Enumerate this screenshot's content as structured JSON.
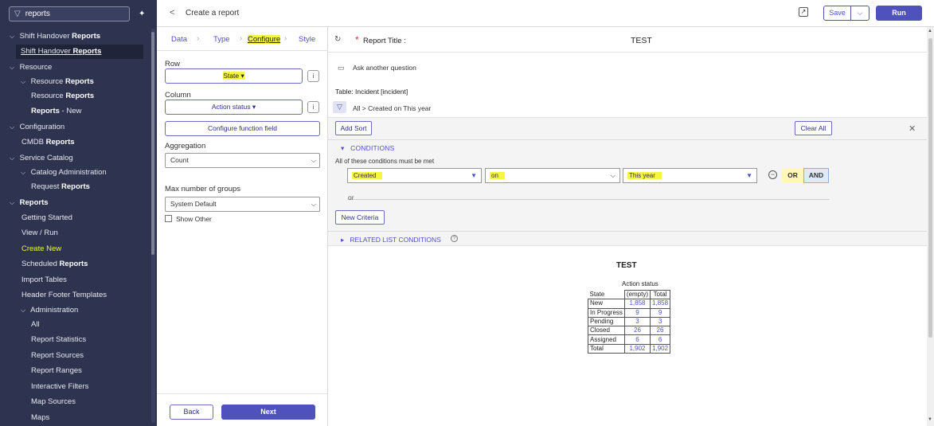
{
  "nav": {
    "search_value": "reports",
    "items": [
      {
        "prefix": "Shift Handover ",
        "bold": "Reports",
        "suffix": "",
        "chev": "⌵"
      },
      {
        "prefix": "Shift Handover ",
        "bold": "Reports",
        "suffix": "",
        "chev": ""
      },
      {
        "prefix": "Resource",
        "bold": "",
        "suffix": "",
        "chev": "⌵"
      },
      {
        "prefix": "Resource ",
        "bold": "Reports",
        "suffix": "",
        "chev": "⌵"
      },
      {
        "prefix": "Resource ",
        "bold": "Reports",
        "suffix": "",
        "chev": ""
      },
      {
        "prefix": "",
        "bold": "Reports",
        "suffix": " - New",
        "chev": ""
      },
      {
        "prefix": "Configuration",
        "bold": "",
        "suffix": "",
        "chev": "⌵"
      },
      {
        "prefix": "CMDB ",
        "bold": "Reports",
        "suffix": "",
        "chev": ""
      },
      {
        "prefix": "Service Catalog",
        "bold": "",
        "suffix": "",
        "chev": "⌵"
      },
      {
        "prefix": "Catalog Administration",
        "bold": "",
        "suffix": "",
        "chev": "⌵"
      },
      {
        "prefix": "Request ",
        "bold": "Reports",
        "suffix": "",
        "chev": ""
      },
      {
        "prefix": "",
        "bold": "Reports",
        "suffix": "",
        "chev": "⌵"
      },
      {
        "prefix": "Getting Started",
        "bold": "",
        "suffix": "",
        "chev": ""
      },
      {
        "prefix": "View / Run",
        "bold": "",
        "suffix": "",
        "chev": ""
      },
      {
        "prefix": "Create New",
        "bold": "",
        "suffix": "",
        "chev": ""
      },
      {
        "prefix": "Scheduled ",
        "bold": "Reports",
        "suffix": "",
        "chev": ""
      },
      {
        "prefix": "Import Tables",
        "bold": "",
        "suffix": "",
        "chev": ""
      },
      {
        "prefix": "Header Footer Templates",
        "bold": "",
        "suffix": "",
        "chev": ""
      },
      {
        "prefix": "Administration",
        "bold": "",
        "suffix": "",
        "chev": "⌵"
      },
      {
        "prefix": "All",
        "bold": "",
        "suffix": "",
        "chev": ""
      },
      {
        "prefix": "Report Statistics",
        "bold": "",
        "suffix": "",
        "chev": ""
      },
      {
        "prefix": "Report Sources",
        "bold": "",
        "suffix": "",
        "chev": ""
      },
      {
        "prefix": "Report Ranges",
        "bold": "",
        "suffix": "",
        "chev": ""
      },
      {
        "prefix": "Interactive Filters",
        "bold": "",
        "suffix": "",
        "chev": ""
      },
      {
        "prefix": "Map Sources",
        "bold": "",
        "suffix": "",
        "chev": ""
      },
      {
        "prefix": "Maps",
        "bold": "",
        "suffix": "",
        "chev": ""
      }
    ]
  },
  "topbar": {
    "back": "<",
    "title": "Create a report",
    "save": "Save",
    "save_dd": "⌵",
    "run": "Run"
  },
  "steps": {
    "data": "Data",
    "type": "Type",
    "configure": "Configure",
    "style": "Style"
  },
  "config": {
    "row_label": "Row",
    "row_value": "State ▾",
    "column_label": "Column",
    "column_value": "Action status ▾",
    "info": "i",
    "configure_fn": "Configure function field",
    "aggregation_label": "Aggregation",
    "aggregation_value": "Count",
    "max_groups_label": "Max number of groups",
    "max_groups_value": "System Default",
    "show_other": "Show Other",
    "back": "Back",
    "next": "Next"
  },
  "main": {
    "report_title_label": "Report Title :",
    "report_title_value": "TEST",
    "ask": "Ask another question",
    "table": "Table: Incident [incident]",
    "breadcrumb": "All  >  Created on This year",
    "add_sort": "Add Sort",
    "clear_all": "Clear All",
    "conditions": "CONDITIONS",
    "cond_note": "All of these conditions must be met",
    "cond_field": "Created",
    "cond_op": "on",
    "cond_value": "This year",
    "or": "OR",
    "and": "AND",
    "or_sep": "or",
    "new_criteria": "New Criteria",
    "related": "RELATED LIST CONDITIONS"
  },
  "preview": {
    "title": "TEST",
    "col_header": "Action status",
    "row_header": "State",
    "columns": [
      "(empty)",
      "Total"
    ],
    "rows": [
      {
        "label": "New",
        "values": [
          "1,858",
          "1,858"
        ]
      },
      {
        "label": "In Progress",
        "values": [
          "9",
          "9"
        ]
      },
      {
        "label": "Pending",
        "values": [
          "3",
          "3"
        ]
      },
      {
        "label": "Closed",
        "values": [
          "26",
          "26"
        ]
      },
      {
        "label": "Assigned",
        "values": [
          "6",
          "6"
        ]
      },
      {
        "label": "Total",
        "values": [
          "1,902",
          "1,902"
        ]
      }
    ]
  },
  "colors": {
    "nav_bg": "#2e3450",
    "accent": "#4f52bd",
    "highlight": "#f5f542"
  }
}
